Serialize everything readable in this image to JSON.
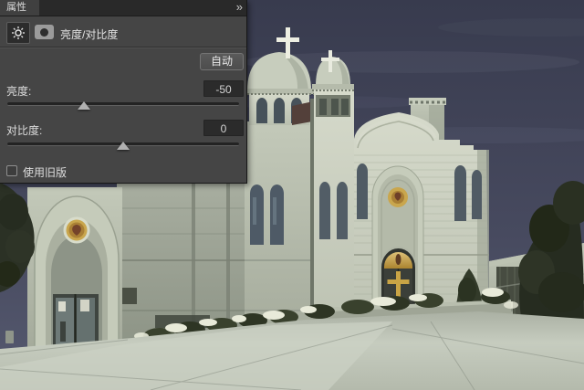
{
  "panel": {
    "title_tab": "属性",
    "collapse_icon": "»",
    "adjustment": {
      "title": "亮度/对比度"
    },
    "auto_button": "自动",
    "brightness": {
      "label": "亮度:",
      "value": "-50",
      "thumb_percent": 33
    },
    "contrast": {
      "label": "对比度:",
      "value": "0",
      "thumb_percent": 50
    },
    "legacy": {
      "label": "使用旧版",
      "checked": false
    }
  },
  "photo": {
    "subject": "white stone church with two domed towers, crosses, arched entrances, flower beds and pavement under a dark blue sky",
    "colors": {
      "sky_top": "#383b4e",
      "sky_horizon": "#565a70",
      "stone_light": "#d2d6c7",
      "stone_mid": "#b8beae",
      "stone_shadow": "#99a092",
      "window_glass": "#505b64",
      "gold": "#c9a445",
      "door_dark": "#34382f",
      "foliage_dark": "#272d20",
      "flowers_white": "#e8ead9",
      "pavement": "#c6ccbf"
    }
  }
}
